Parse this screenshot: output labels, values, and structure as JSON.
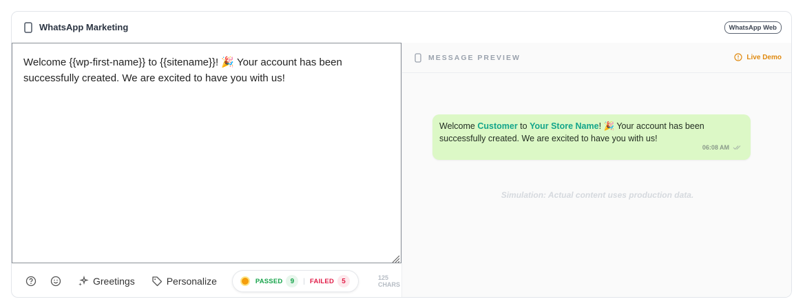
{
  "header": {
    "title": "WhatsApp Marketing",
    "badge": "WhatsApp Web"
  },
  "editor": {
    "value": "Welcome {{wp-first-name}} to {{sitename}}! 🎉 Your account has been successfully created. We are excited to have you with us!"
  },
  "toolbar": {
    "greetings_label": "Greetings",
    "personalize_label": "Personalize",
    "passed_label": "PASSED",
    "passed_count": "9",
    "failed_label": "FAILED",
    "failed_count": "5",
    "separator": "|",
    "char_count": "125 CHARS"
  },
  "preview": {
    "title": "MESSAGE PREVIEW",
    "live_demo_label": "Live Demo",
    "message": {
      "part1": "Welcome ",
      "customer": "Customer",
      "part2": " to ",
      "store": "Your Store Name",
      "part3": "! 🎉 Your account has been successfully created. We are excited to have you with us!",
      "time": "06:08 AM"
    },
    "simulation_note": "Simulation: Actual content uses production data."
  },
  "colors": {
    "accent_green": "#14a58a",
    "bubble_bg": "#dcf8c6",
    "passed": "#16a34a",
    "failed": "#e11d48",
    "live_demo": "#e08a10"
  }
}
